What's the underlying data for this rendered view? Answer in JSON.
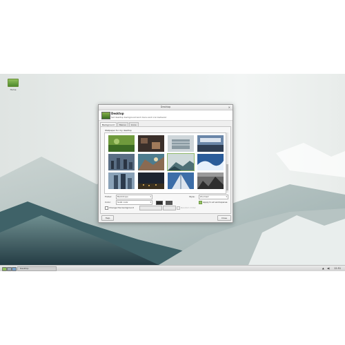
{
  "desktop": {
    "icons": [
      {
        "label": "Home"
      }
    ]
  },
  "window": {
    "title": "Desktop",
    "close_glyph": "✕",
    "header": {
      "title": "Desktop",
      "subtitle": "Set desktop background and menu and icon behavior",
      "icon": "desktop-settings-icon"
    },
    "tabs": [
      {
        "label": "Background",
        "active": true
      },
      {
        "label": "Menus",
        "active": false
      },
      {
        "label": "Icons",
        "active": false
      }
    ],
    "wallpaper_label": "Wallpaper for my desktop",
    "folder": {
      "label": "Folder:",
      "value": "Backdrops"
    },
    "style": {
      "label": "Style:",
      "value": "Zoomed"
    },
    "color": {
      "label": "Color:",
      "value": "Solid color"
    },
    "apply_all": {
      "label": "Apply to all workspaces",
      "checked": true
    },
    "change_background": {
      "label": "Change the background",
      "checked": false
    },
    "random_order": {
      "label": "Random Order",
      "checked": false
    },
    "buttons": {
      "help": "Help",
      "close": "Close"
    }
  },
  "taskbar": {
    "task_label": "Desktop",
    "tray": {
      "network": "▲",
      "volume": "◀)",
      "clock": "12:51"
    }
  },
  "colors": {
    "accent_green": "#9ac068",
    "window_bg": "#efefef",
    "taskbar_bg": "#dcdcdc",
    "color_swatch": "#2b2b2b"
  }
}
